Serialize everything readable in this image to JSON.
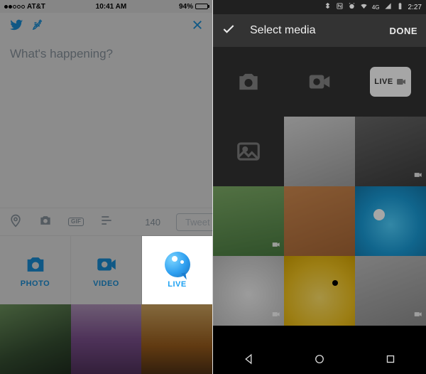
{
  "ios": {
    "status": {
      "carrier": "AT&T",
      "time": "10:41 AM",
      "battery_text": "94%",
      "battery_pct": 94
    },
    "compose": {
      "placeholder": "What's happening?"
    },
    "toolbar": {
      "gif_label": "GIF",
      "char_count": "140",
      "tweet_label": "Tweet"
    },
    "picker": {
      "photo": "PHOTO",
      "video": "VIDEO",
      "live": "LIVE"
    }
  },
  "android": {
    "status": {
      "net_label": "4G",
      "time": "2:27"
    },
    "header": {
      "title": "Select media",
      "done": "DONE"
    },
    "live_label": "LIVE"
  }
}
